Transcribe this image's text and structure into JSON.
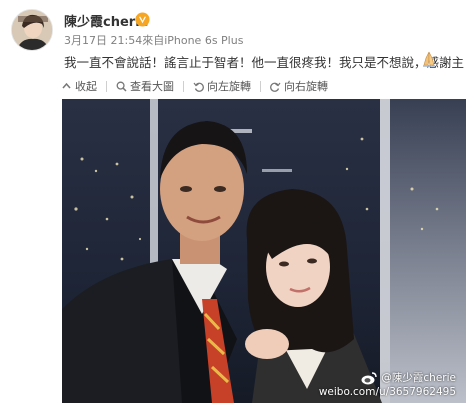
{
  "post": {
    "username": "陳少霞cherie",
    "meta": "3月17日 21:54來自iPhone 6s Plus",
    "text": "我一直不會說話！謠言止于智者！他一直很疼我！我只是不想說，感謝主"
  },
  "toolbar": {
    "collapse_label": "收起",
    "view_large_label": "查看大圖",
    "rotate_left_label": "向左旋轉",
    "rotate_right_label": "向右旋轉"
  },
  "photo": {
    "watermark_name": "@陳少霞cherie",
    "watermark_url": "weibo.com/u/3657962495"
  },
  "icons": {
    "verified": "verified-badge-icon",
    "emoji": "praying-hands-emoji-icon",
    "collapse": "arrow-up-icon",
    "view_large": "magnifier-icon",
    "rotate_left": "rotate-left-icon",
    "rotate_right": "rotate-right-icon",
    "weibo": "weibo-logo-icon"
  },
  "colors": {
    "verified_badge": "#f5a623",
    "meta_text": "#808080",
    "toolbar_text": "#555555"
  }
}
